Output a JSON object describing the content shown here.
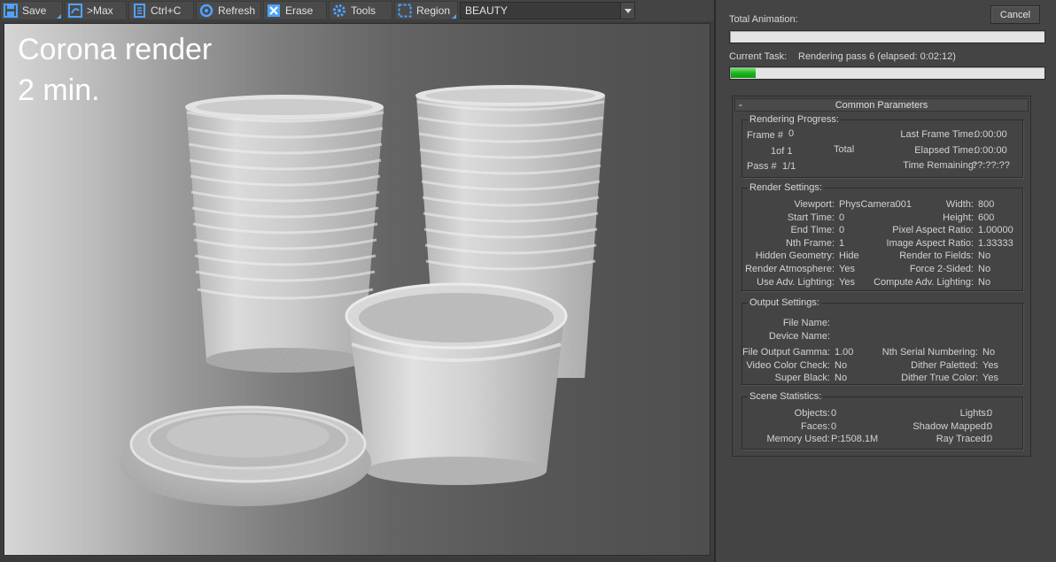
{
  "toolbar": {
    "buttons": [
      {
        "label": "Save",
        "icon": "save-icon"
      },
      {
        "label": ">Max",
        "icon": "max-icon"
      },
      {
        "label": "Ctrl+C",
        "icon": "copy-icon"
      },
      {
        "label": "Refresh",
        "icon": "refresh-icon"
      },
      {
        "label": "Erase",
        "icon": "erase-icon"
      },
      {
        "label": "Tools",
        "icon": "gear-icon"
      },
      {
        "label": "Region",
        "icon": "region-icon"
      }
    ],
    "channel": "BEAUTY"
  },
  "overlay": {
    "line1": "Corona render",
    "line2": "2 min."
  },
  "colors": {
    "accent": "#4fa3ff",
    "progress": "#1bb51b",
    "panel": "#444444"
  },
  "dialog": {
    "cancel_label": "Cancel",
    "total_animation_label": "Total Animation:",
    "total_animation_progress": 0,
    "current_task_label": "Current Task:",
    "current_task_value": "Rendering pass 6 (elapsed: 0:02:12)",
    "current_task_progress": 0.08,
    "rollout_title": "Common Parameters",
    "rollout_toggle": "-",
    "rendering_progress": {
      "title": "Rendering Progress:",
      "frame_label": "Frame #",
      "frame_value": "0",
      "of_text": "1of 1",
      "total_text": "Total",
      "pass_label": "Pass #",
      "pass_value": "1/1",
      "last_frame_label": "Last Frame Time:",
      "last_frame_value": "0:00:00",
      "elapsed_label": "Elapsed Time:",
      "elapsed_value": "0:00:00",
      "remaining_label": "Time Remaining:",
      "remaining_value": "??:??:??"
    },
    "render_settings": {
      "title": "Render Settings:",
      "left": [
        {
          "label": "Viewport:",
          "value": "PhysCamera001"
        },
        {
          "label": "Start Time:",
          "value": "0"
        },
        {
          "label": "End Time:",
          "value": "0"
        },
        {
          "label": "Nth Frame:",
          "value": "1"
        },
        {
          "label": "Hidden Geometry:",
          "value": "Hide"
        },
        {
          "label": "Render Atmosphere:",
          "value": "Yes"
        },
        {
          "label": "Use Adv. Lighting:",
          "value": "Yes"
        }
      ],
      "right": [
        {
          "label": "Width:",
          "value": "800"
        },
        {
          "label": "Height:",
          "value": "600"
        },
        {
          "label": "Pixel Aspect Ratio:",
          "value": "1.00000"
        },
        {
          "label": "Image Aspect Ratio:",
          "value": "1.33333"
        },
        {
          "label": "Render to Fields:",
          "value": "No"
        },
        {
          "label": "Force 2-Sided:",
          "value": "No"
        },
        {
          "label": "Compute Adv. Lighting:",
          "value": "No"
        }
      ]
    },
    "output_settings": {
      "title": "Output Settings:",
      "file_name_label": "File Name:",
      "device_name_label": "Device Name:",
      "left": [
        {
          "label": "File Output Gamma:",
          "value": "1.00"
        },
        {
          "label": "Video Color Check:",
          "value": "No"
        },
        {
          "label": "Super Black:",
          "value": "No"
        }
      ],
      "right": [
        {
          "label": "Nth Serial Numbering:",
          "value": "No"
        },
        {
          "label": "Dither Paletted:",
          "value": "Yes"
        },
        {
          "label": "Dither True Color:",
          "value": "Yes"
        }
      ]
    },
    "scene_statistics": {
      "title": "Scene Statistics:",
      "left": [
        {
          "label": "Objects:",
          "value": "0"
        },
        {
          "label": "Faces:",
          "value": "0"
        },
        {
          "label": "Memory Used:",
          "value": "P:1508.1M"
        }
      ],
      "right": [
        {
          "label": "Lights:",
          "value": "0"
        },
        {
          "label": "Shadow Mapped:",
          "value": "0"
        },
        {
          "label": "Ray Traced:",
          "value": "0"
        }
      ]
    }
  }
}
